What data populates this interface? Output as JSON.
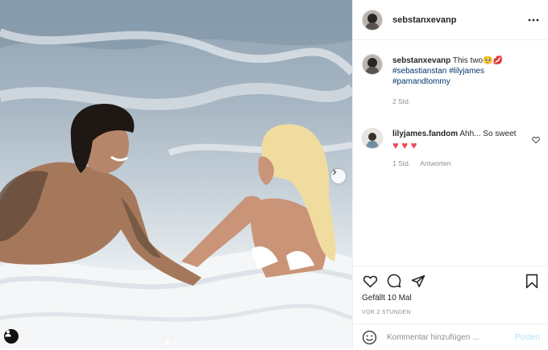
{
  "post": {
    "username": "sebstanxevanp",
    "more_icon": "more-horizontal-icon"
  },
  "caption": {
    "username": "sebstanxevanp",
    "text": "This two",
    "emojis": [
      "🥺",
      "💋"
    ],
    "hashtags": [
      "#sebastianstan",
      "#lilyjames",
      "#pamandtommy"
    ],
    "time": "2 Std."
  },
  "comment": {
    "username": "lilyjames.fandom",
    "text": "Ahh... So sweet",
    "hearts": [
      "♥",
      "♥",
      "♥"
    ],
    "time": "1 Std.",
    "reply_label": "Antworten"
  },
  "actions": {
    "icons": [
      "heart-icon",
      "comment-icon",
      "share-icon",
      "bookmark-icon"
    ],
    "likes": "Gefällt 10 Mal",
    "posted": "vor 2 Stunden"
  },
  "composer": {
    "placeholder": "Kommentar hinzufügen ...",
    "post_label": "Posten"
  },
  "colors": {
    "link": "#00376b",
    "heart_red": "#ed4956",
    "post_disabled": "#b2dffc",
    "muted": "#8e8e8e"
  }
}
